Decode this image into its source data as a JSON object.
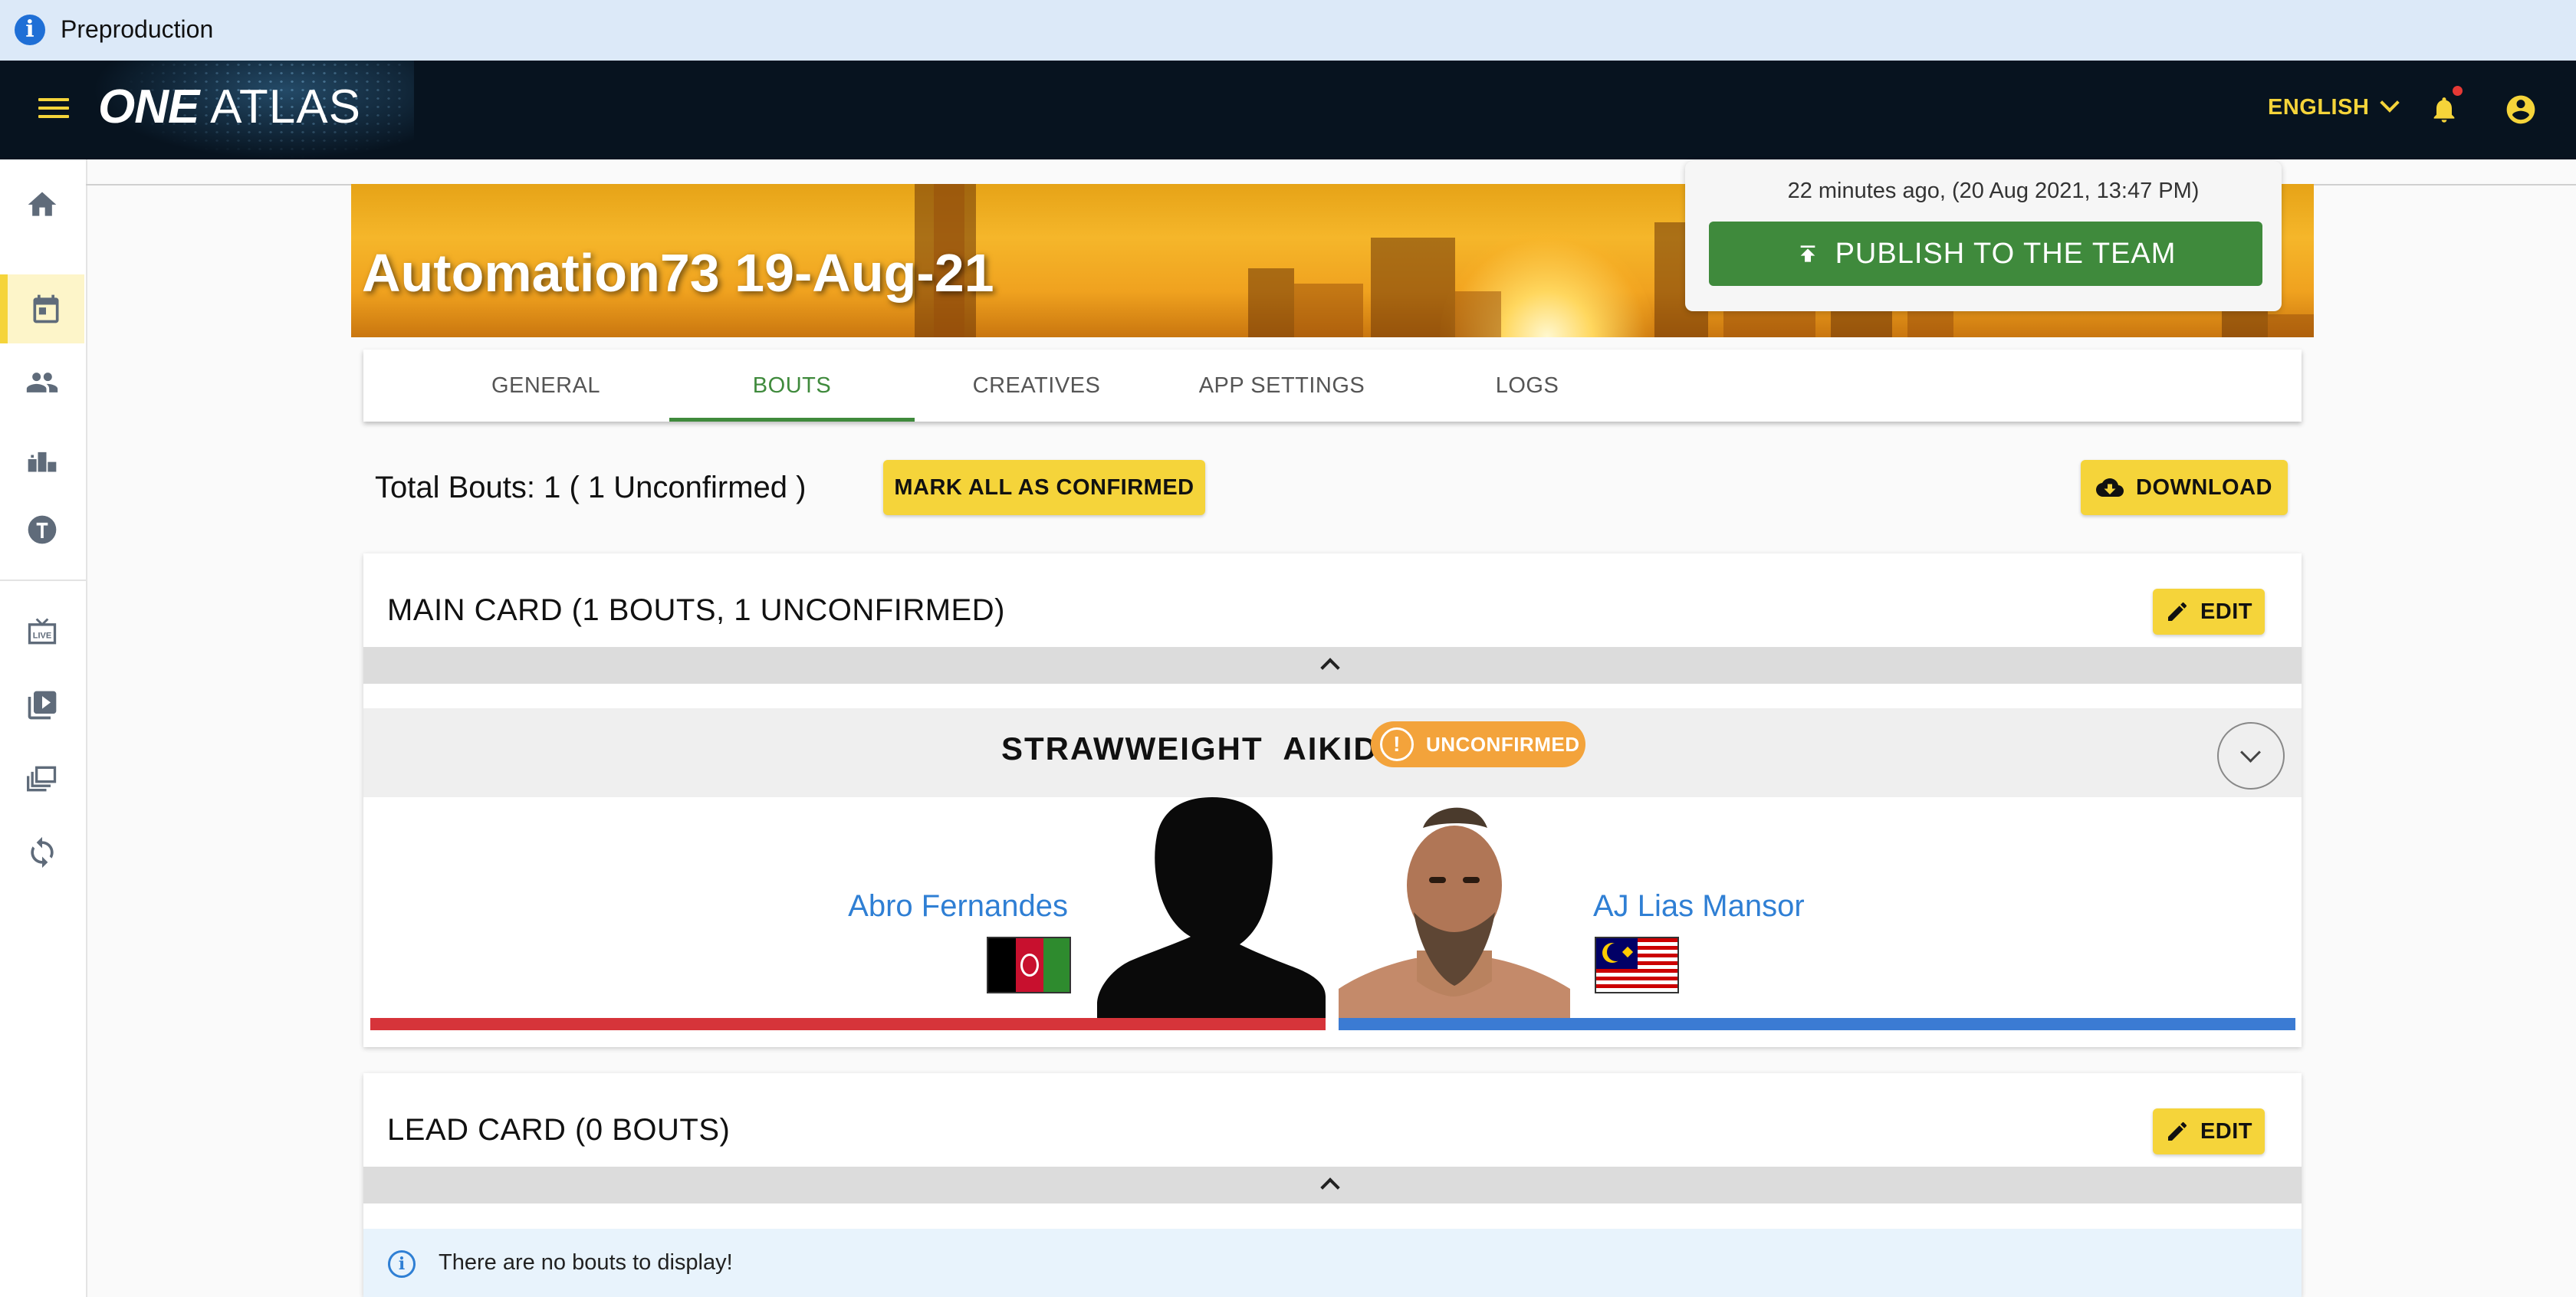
{
  "env_banner": {
    "label": "Preproduction",
    "icon": "info-icon"
  },
  "header": {
    "logo_one": "ONE",
    "logo_atlas": "ATLAS",
    "language": "ENGLISH",
    "icons": [
      "menu-icon",
      "bell-icon",
      "account-icon"
    ]
  },
  "sidebar": {
    "items": [
      {
        "name": "home",
        "icon": "home-icon"
      },
      {
        "name": "events",
        "icon": "calendar-icon",
        "active": true
      },
      {
        "name": "people",
        "icon": "people-icon"
      },
      {
        "name": "rankings",
        "icon": "podium-icon"
      },
      {
        "name": "teams",
        "icon": "shield-icon"
      },
      {
        "name": "live",
        "icon": "live-tv-icon"
      },
      {
        "name": "videos",
        "icon": "video-library-icon"
      },
      {
        "name": "gallery",
        "icon": "gallery-icon"
      },
      {
        "name": "sync",
        "icon": "sync-icon"
      }
    ]
  },
  "event": {
    "title": "Automation73 19-Aug-21",
    "last_published": "22 minutes ago, (20 Aug 2021, 13:47 PM)",
    "publish_label": "PUBLISH TO THE TEAM"
  },
  "tabs": [
    {
      "label": "GENERAL",
      "active": false
    },
    {
      "label": "BOUTS",
      "active": true
    },
    {
      "label": "CREATIVES",
      "active": false
    },
    {
      "label": "APP SETTINGS",
      "active": false
    },
    {
      "label": "LOGS",
      "active": false
    }
  ],
  "bouts_toolbar": {
    "totals": "Total Bouts: 1 ( 1 Unconfirmed )",
    "mark_all_label": "MARK ALL AS CONFIRMED",
    "download_label": "DOWNLOAD"
  },
  "main_card": {
    "title": "MAIN CARD (1 BOUTS, 1 UNCONFIRMED)",
    "edit_label": "EDIT",
    "bout": {
      "title": "STRAWWEIGHT  AIKIDO",
      "status": "UNCONFIRMED",
      "red_corner": {
        "name": "Abro Fernandes",
        "flag": "afghanistan-flag"
      },
      "blue_corner": {
        "name": "AJ Lias Mansor",
        "flag": "malaysia-flag"
      }
    }
  },
  "lead_card": {
    "title": "LEAD CARD (0 BOUTS)",
    "edit_label": "EDIT",
    "empty_message": "There are no bouts to display!"
  },
  "colors": {
    "accent_yellow": "#f5d43a",
    "publish_green": "#3f8a3c",
    "header_navy": "#07131f",
    "red_corner": "#d6343a",
    "blue_corner": "#3b7bd3",
    "status_orange": "#f3a33b"
  }
}
